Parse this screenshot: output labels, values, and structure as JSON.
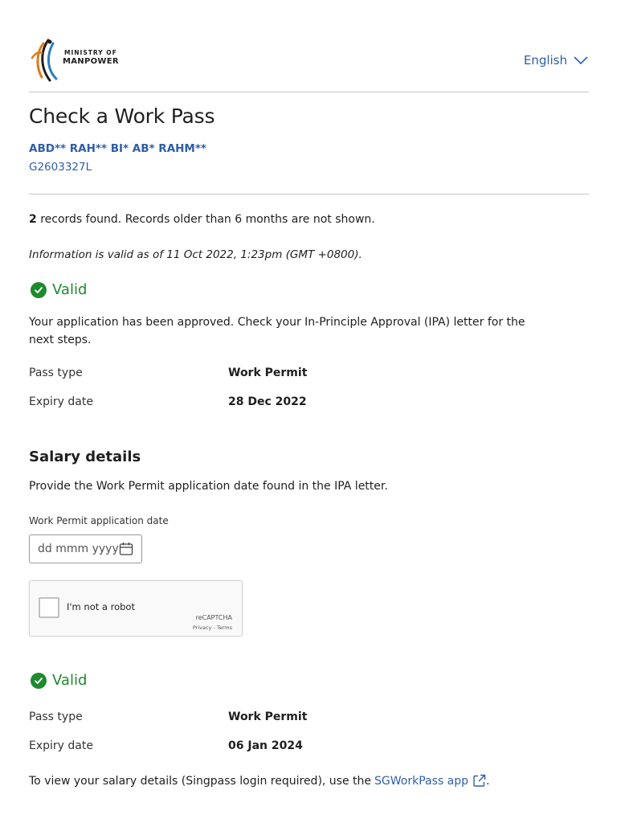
{
  "header": {
    "logo": {
      "line1": "MINISTRY OF",
      "line2": "MANPOWER",
      "icon": "mom-logo-icon"
    },
    "language": {
      "label": "English",
      "icon": "chevron-down-icon"
    }
  },
  "page": {
    "title": "Check a Work Pass",
    "holder_name": "ABD** RAH** BI* AB* RAHM**",
    "holder_id": "G2603327L"
  },
  "summary": {
    "count": "2",
    "text": " records found. Records older than 6 months are not shown.",
    "validity": "Information is valid as of 11 Oct 2022, 1:23pm (GMT +0800)."
  },
  "records": [
    {
      "status": "Valid",
      "message": "Your application has been approved. Check your In-Principle Approval (IPA) letter for the next steps.",
      "pass_type_label": "Pass type",
      "pass_type": "Work Permit",
      "expiry_label": "Expiry date",
      "expiry": "28 Dec 2022"
    },
    {
      "status": "Valid",
      "pass_type_label": "Pass type",
      "pass_type": "Work Permit",
      "expiry_label": "Expiry date",
      "expiry": "06 Jan 2024"
    }
  ],
  "salary": {
    "heading": "Salary details",
    "instruction": "Provide the Work Permit application date found in the IPA letter.",
    "field_label": "Work Permit application date",
    "placeholder": "dd mmm yyyy"
  },
  "captcha": {
    "label": "I'm not a robot",
    "brand": "reCAPTCHA",
    "links": "Privacy - Terms"
  },
  "footer": {
    "text": "To view your salary details (Singpass login required), use the ",
    "link": "SGWorkPass app",
    "end": "."
  },
  "colors": {
    "link": "#2f5ea8",
    "valid": "#1e8a2f",
    "text": "#1f1f1f"
  }
}
